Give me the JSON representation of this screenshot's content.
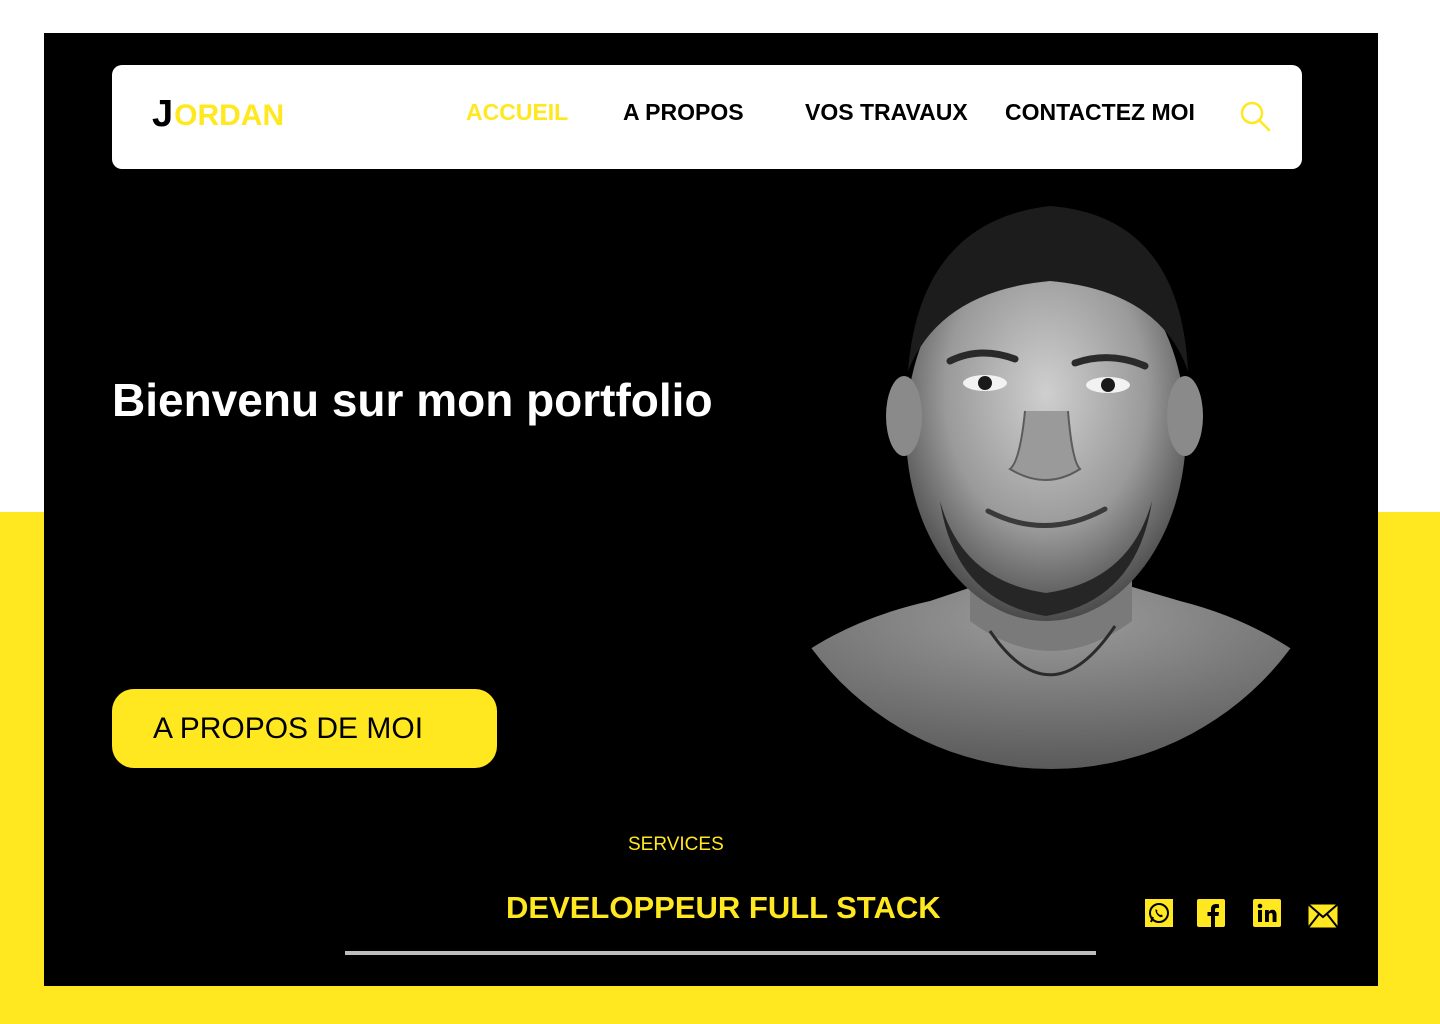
{
  "colors": {
    "accent": "#FFE81F",
    "background": "#000000",
    "nav_bg": "#ffffff",
    "underline": "#bdbdbd"
  },
  "logo": {
    "initial": "J",
    "rest": "ORDAN"
  },
  "nav": {
    "items": [
      {
        "label": "ACCUEIL",
        "active": true
      },
      {
        "label": "A PROPOS",
        "active": false
      },
      {
        "label": "VOS TRAVAUX",
        "active": false
      },
      {
        "label": "CONTACTEZ MOI",
        "active": false
      }
    ],
    "search_icon": "search-icon"
  },
  "hero": {
    "title": "Bienvenu sur mon portfolio",
    "cta_label": "A PROPOS DE MOI",
    "portrait_icon": "portrait-photo"
  },
  "services": {
    "label": "SERVICES",
    "title": "DEVELOPPEUR FULL STACK"
  },
  "social": {
    "icons": [
      "whatsapp-icon",
      "facebook-icon",
      "linkedin-icon",
      "mail-icon"
    ]
  }
}
